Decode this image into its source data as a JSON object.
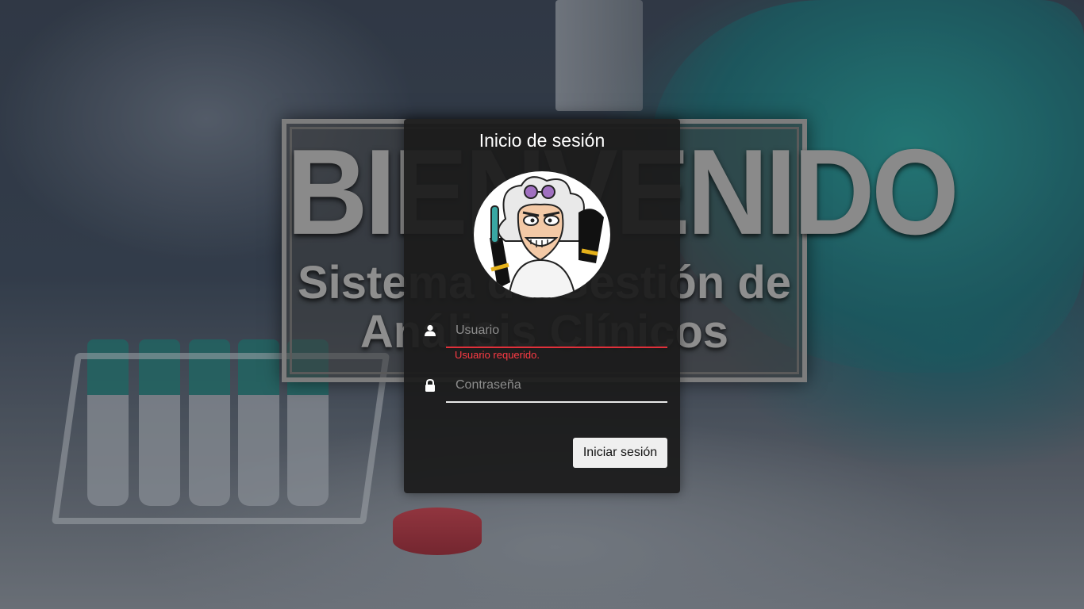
{
  "banner": {
    "title": "BIENVENIDO",
    "subtitle_line1": "Sistema de Gestión de",
    "subtitle_line2": "Análisis Clínicos"
  },
  "login": {
    "title": "Inicio de sesión",
    "avatar_icon": "mad-scientist-avatar",
    "username": {
      "placeholder": "Usuario",
      "value": "",
      "icon": "user-icon",
      "error": "Usuario requerido."
    },
    "password": {
      "placeholder": "Contraseña",
      "value": "",
      "icon": "lock-icon"
    },
    "submit_label": "Iniciar sesión"
  },
  "colors": {
    "card_bg": "#1b1b1b",
    "error": "#ff3b44",
    "button_bg": "#efefef"
  }
}
